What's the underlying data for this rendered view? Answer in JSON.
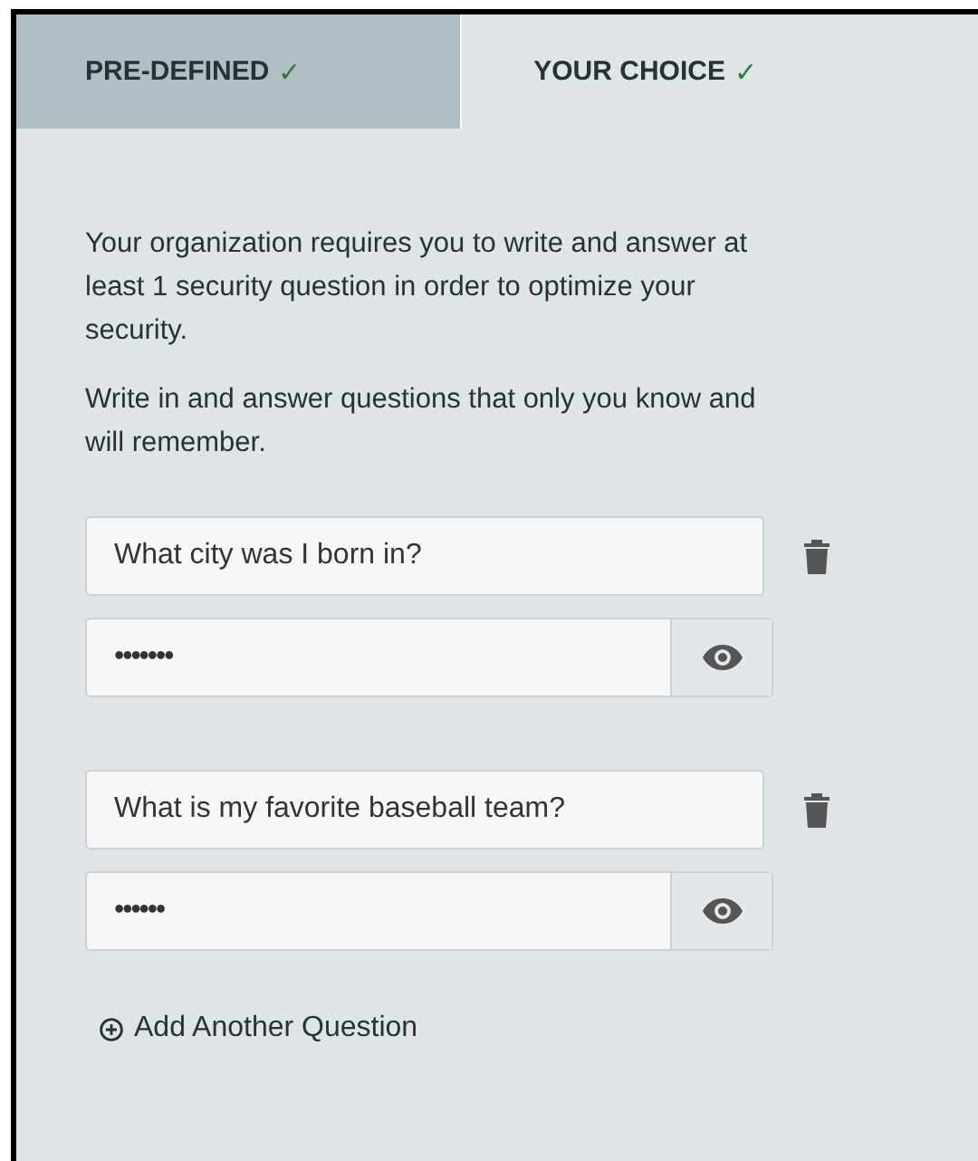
{
  "tabs": [
    {
      "label": "PRE-DEFINED",
      "check": "✓",
      "selected": false
    },
    {
      "label": "YOUR CHOICE",
      "check": "✓",
      "selected": true
    }
  ],
  "intro": [
    "Your organization requires you to write and answer at least 1 security question in order to optimize your security.",
    "Write in and answer questions that only you know and will remember."
  ],
  "questions": [
    {
      "question": "What city was I born in?",
      "answer": "•••••••"
    },
    {
      "question": "What is my favorite baseball team?",
      "answer": "••••••"
    }
  ],
  "add_button": "Add Another Question"
}
